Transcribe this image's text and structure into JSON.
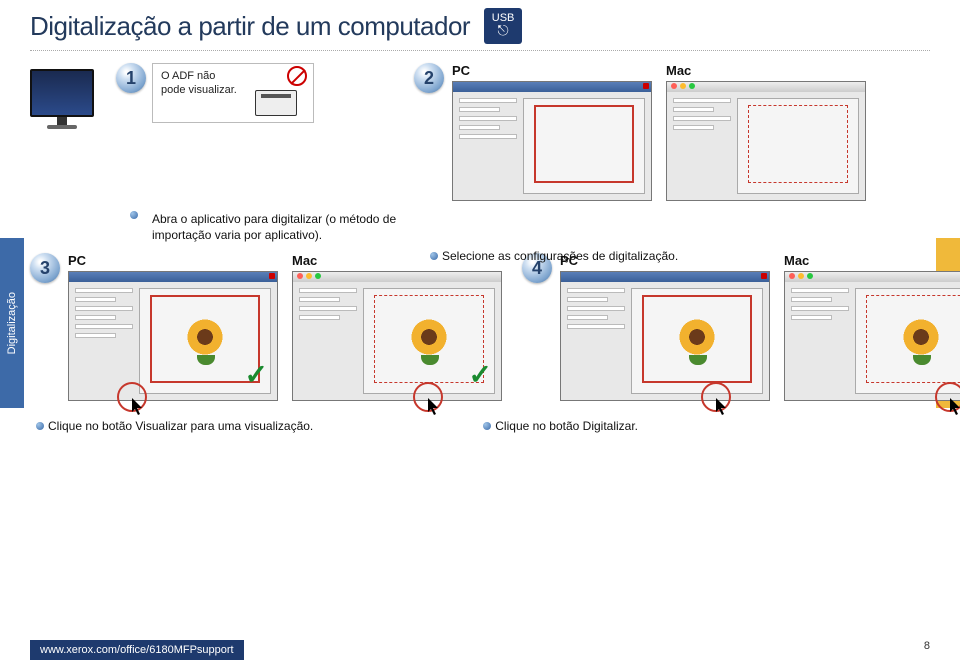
{
  "page": {
    "title": "Digitalização a partir de um computador",
    "usb_label": "USB"
  },
  "steps": {
    "one": "1",
    "two": "2",
    "three": "3",
    "four": "4"
  },
  "adf_note": "O ADF não pode visualizar.",
  "os_labels": {
    "pc": "PC",
    "mac": "Mac"
  },
  "hints": {
    "open_app": "Abra o aplicativo para digitalizar (o método de importação varia por aplicativo).",
    "select_settings": "Selecione as configurações de digitalização."
  },
  "captions": {
    "preview_click": "Clique no botão Visualizar para uma visualização.",
    "preview_click_italic": "Visualizar",
    "scan_click": "Clique no botão Digitalizar.",
    "scan_click_italic": "Digitalizar"
  },
  "side_tab": "Digitalização",
  "footer": {
    "url": "www.xerox.com/office/6180MFPsupport",
    "page_number": "8"
  }
}
